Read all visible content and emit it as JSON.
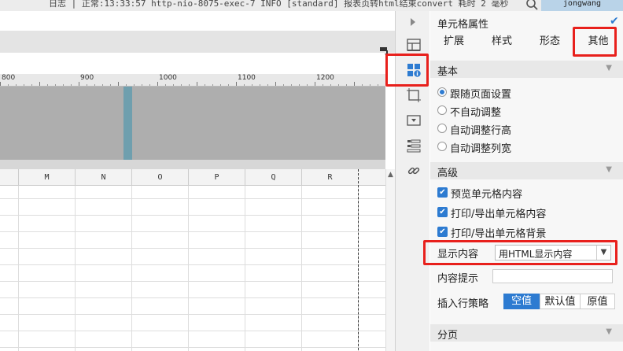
{
  "log": {
    "text": "日志 | 正常:13:33:57 http-nio-8075-exec-7 INFO [standard] 报表页转html结束convert 耗时 2 毫秒",
    "user": "jongwang"
  },
  "ruler": {
    "labels": [
      "800",
      "900",
      "1000",
      "1100",
      "1200",
      "1"
    ]
  },
  "grid": {
    "columns": [
      "M",
      "N",
      "O",
      "P",
      "Q",
      "R"
    ]
  },
  "panel": {
    "title": "单元格属性",
    "tabs": [
      "扩展",
      "样式",
      "形态",
      "其他"
    ],
    "basic": {
      "label": "基本",
      "options": [
        {
          "label": "跟随页面设置",
          "selected": true
        },
        {
          "label": "不自动调整",
          "selected": false
        },
        {
          "label": "自动调整行高",
          "selected": false
        },
        {
          "label": "自动调整列宽",
          "selected": false
        }
      ]
    },
    "advanced": {
      "label": "高级",
      "checks": [
        {
          "label": "预览单元格内容",
          "checked": true
        },
        {
          "label": "打印/导出单元格内容",
          "checked": true
        },
        {
          "label": "打印/导出单元格背景",
          "checked": true
        }
      ],
      "display_label": "显示内容",
      "display_value": "用HTML显示内容",
      "tooltip_label": "内容提示",
      "tooltip_value": "",
      "insert_label": "插入行策略",
      "insert_options": [
        "空值",
        "默认值",
        "原值"
      ],
      "insert_selected": "空值"
    },
    "paging": {
      "label": "分页"
    }
  },
  "colors": {
    "accent": "#2d7bd1",
    "highlight": "#e8201c"
  }
}
